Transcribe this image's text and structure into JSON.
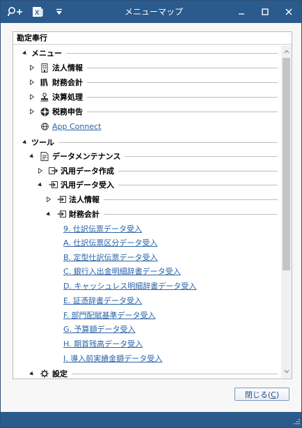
{
  "window": {
    "title": "メニューマップ",
    "controls": {
      "minimize": "–",
      "maximize": "□",
      "close": "✕"
    }
  },
  "panel": {
    "header": "勘定奉行"
  },
  "tree": {
    "menu": {
      "label": "メニュー"
    },
    "hojin": {
      "label": "法人情報"
    },
    "zaimu": {
      "label": "財務会計"
    },
    "kessan": {
      "label": "決算処理"
    },
    "zeimu": {
      "label": "税務申告"
    },
    "appconnect": {
      "label": "App Connect"
    },
    "tool": {
      "label": "ツール"
    },
    "datamaint": {
      "label": "データメンテナンス"
    },
    "hanyo_sakusei": {
      "label": "汎用データ作成"
    },
    "hanyo_ukeire": {
      "label": "汎用データ受入"
    },
    "ukeire_hojin": {
      "label": "法人情報"
    },
    "ukeire_zaimu": {
      "label": "財務会計"
    },
    "links": [
      "9. 仕訳伝票データ受入",
      "A. 仕訳伝票区分データ受入",
      "B. 定型仕訳伝票データ受入",
      "C. 銀行入出金明細辞書データ受入",
      "D. キャッシュレス明細辞書データ受入",
      "E. 証憑辞書データ受入",
      "F. 部門配賦基準データ受入",
      "G. 予算額データ受入",
      "H. 期首残高データ受入",
      "I. 導入前実績金額データ受入"
    ],
    "settei": {
      "label": "設定"
    }
  },
  "footer": {
    "close_label": "閉じる(",
    "close_key": "C",
    "close_suffix": ")"
  },
  "colors": {
    "titlebar": "#2b5a8c",
    "link": "#2a63a6",
    "accent_border": "#7a98be"
  }
}
